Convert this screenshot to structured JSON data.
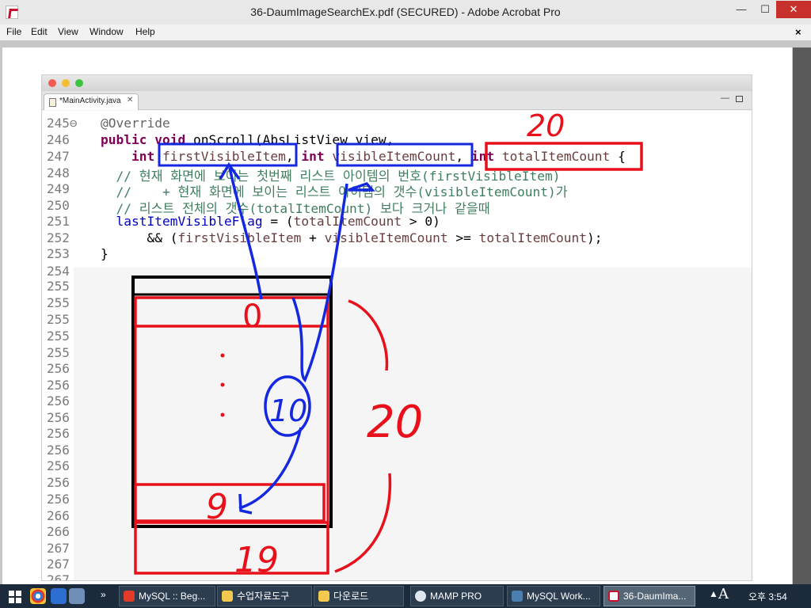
{
  "window": {
    "title": "36-DaumImageSearchEx.pdf (SECURED) - Adobe Acrobat Pro",
    "min_glyph": "—",
    "max_glyph": "☐",
    "close_glyph": "✕"
  },
  "menu": {
    "items": [
      "File",
      "Edit",
      "View",
      "Window",
      "Help"
    ],
    "close_doc": "×"
  },
  "eclipse": {
    "tab_label": "*MainActivity.java",
    "tab_close": "✕",
    "line_numbers": [
      "245⊖",
      "246",
      "247",
      "248",
      "249",
      "250",
      "251",
      "252",
      "253",
      "254",
      "255",
      "255",
      "255",
      "255",
      "255",
      "256",
      "256",
      "256",
      "256",
      "256",
      "256",
      "256",
      "256",
      "256",
      "266",
      "266",
      "267",
      "267",
      "267"
    ],
    "code": {
      "l245": "@Override",
      "l246_kw1": "public",
      "l246_kw2": "void",
      "l246_rest": "onScroll(AbsListView view,",
      "l247_int1": "int",
      "l247_p1": "firstVisibleItem",
      "l247_comma1": ",",
      "l247_int2": "int",
      "l247_p2": "visibleItemCount",
      "l247_comma2": ",",
      "l247_int3": "int",
      "l247_p3": "totalItemCount",
      "l247_brace": "{",
      "l248": "// 현재 화면에 보이는 첫번째 리스트 아이템의 번호(firstVisibleItem)",
      "l249": "//    + 현재 화면에 보이는 리스트 아이템의 갯수(visibleItemCount)가",
      "l250": "// 리스트 전체의 갯수(totalItemCount) 보다 크거나 같을때",
      "l251_field": "lastItemVisibleFlag",
      "l251_op": " = (",
      "l251_param": "totalItemCount",
      "l251_end": " > 0)",
      "l252_op": "&& (",
      "l252_p1": "firstVisibleItem",
      "l252_plus": " + ",
      "l252_p2": "visibleItemCount",
      "l252_ge": " >= ",
      "l252_p3": "totalItemCount",
      "l252_end": ");",
      "l253": "}"
    }
  },
  "annotations": {
    "total_top": "20",
    "row_first": "0",
    "visible_count": "10",
    "total_side": "20",
    "row_visible_last": "9",
    "row_last": "19",
    "red": "#e8111b",
    "blue": "#1428e0",
    "black": "#000000"
  },
  "taskbar": {
    "items": [
      "MySQL :: Beg...",
      "수업자료도구",
      "다운로드",
      "MAMP PRO",
      "MySQL Work...",
      "36-DaumIma..."
    ],
    "tray_chevron": "▲",
    "ime": "A",
    "clock": "오후 3:54"
  }
}
